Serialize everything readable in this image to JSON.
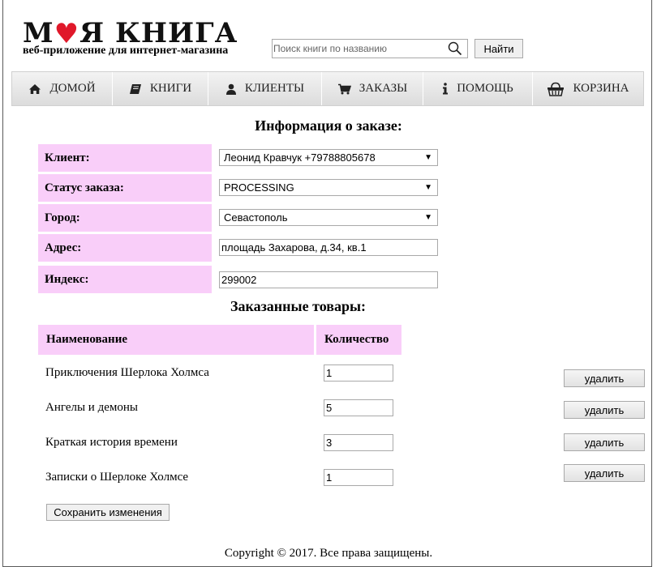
{
  "header": {
    "logo_title_left": "М",
    "logo_title_right": "Я КНИГА",
    "logo_subtitle": "веб-приложение для интернет-магазина",
    "search_placeholder": "Поиск книги по названию",
    "find_label": "Найти"
  },
  "nav": {
    "items": [
      {
        "label": "ДОМОЙ",
        "icon": "home-icon"
      },
      {
        "label": "КНИГИ",
        "icon": "book-icon"
      },
      {
        "label": "КЛИЕНТЫ",
        "icon": "user-icon"
      },
      {
        "label": "ЗАКАЗЫ",
        "icon": "cart-icon"
      },
      {
        "label": "ПОМОЩЬ",
        "icon": "info-icon"
      },
      {
        "label": "КОРЗИНА",
        "icon": "basket-icon"
      }
    ]
  },
  "order": {
    "heading": "Информация о заказе:",
    "client_label": "Клиент:",
    "client_value": "Леонид Кравчук +79788805678",
    "status_label": "Статус заказа:",
    "status_value": "PROCESSING",
    "city_label": "Город:",
    "city_value": "Севастополь",
    "address_label": "Адрес:",
    "address_value": "площадь Захарова, д.34, кв.1",
    "index_label": "Индекс:",
    "index_value": "299002"
  },
  "items": {
    "heading": "Заказанные товары:",
    "col_name": "Наименование",
    "col_qty": "Количество",
    "delete_label": "удалить",
    "rows": [
      {
        "name": "Приключения Шерлока Холмса",
        "qty": "1"
      },
      {
        "name": "Ангелы и демоны",
        "qty": "5"
      },
      {
        "name": "Краткая история времени",
        "qty": "3"
      },
      {
        "name": "Записки о Шерлоке Холмсе",
        "qty": "1"
      }
    ]
  },
  "save_label": "Сохранить изменения",
  "footer": "Copyright © 2017. Все права защищены."
}
